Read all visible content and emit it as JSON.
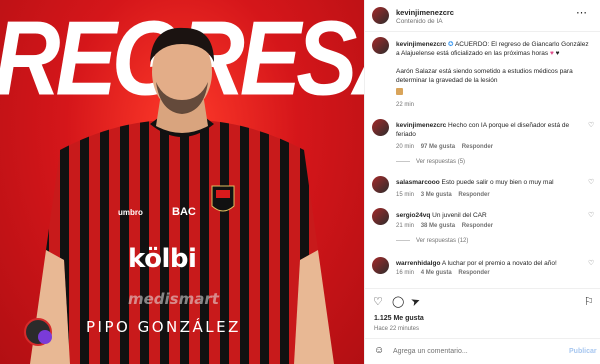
{
  "post": {
    "headline": "REGRESA",
    "player_name": "PIPO GONZÁLEZ",
    "sponsor_primary": "kölbi",
    "sponsor_secondary": "medismart",
    "shirt_sponsor": "BAC",
    "brand": "umbro"
  },
  "header": {
    "username": "kevinjimenezcrc",
    "subtitle": "Contenido de IA",
    "more_icon": "more-horizontal-icon"
  },
  "caption": {
    "username": "kevinjimenezcrc",
    "text_1": "ACUERDO: El regreso de Giancarlo González a Alajuelense está oficializado en las próximas horas",
    "text_2": "Aarón Salazar está siendo sometido a estudios médicos para determinar la gravedad de la lesión",
    "time": "22 min"
  },
  "comments": [
    {
      "username": "kevinjimenezcrc",
      "text": "Hecho con IA porque el diseñador está de feriado",
      "time": "20 min",
      "likes": "97 Me gusta",
      "reply": "Responder",
      "view_replies": "Ver respuestas (5)"
    },
    {
      "username": "salasmarcooo",
      "text": "Esto puede salir o muy bien o muy mal",
      "time": "15 min",
      "likes": "3 Me gusta",
      "reply": "Responder"
    },
    {
      "username": "sergio24vq",
      "text": "Un juvenil del CAR",
      "time": "21 min",
      "likes": "38 Me gusta",
      "reply": "Responder",
      "view_replies": "Ver respuestas (12)"
    },
    {
      "username": "warrenhidalgo",
      "text": "A luchar por el premio a novato del año!",
      "time": "16 min",
      "likes": "4 Me gusta",
      "reply": "Responder"
    }
  ],
  "actions": {
    "likes_count": "1.125 Me gusta",
    "time_ago": "Hace 22 minutes",
    "comment_placeholder": "Agrega un comentario...",
    "publish_label": "Publicar"
  },
  "colors": {
    "accent_red": "#d81a1c",
    "publish_blue": "#a7c7f0",
    "muted": "#737373"
  }
}
